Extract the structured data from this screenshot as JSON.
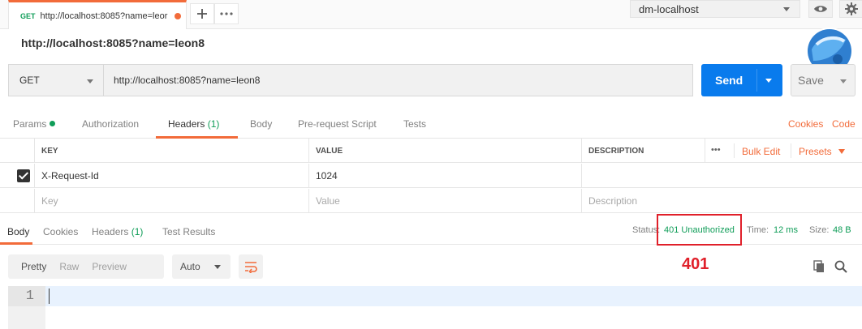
{
  "tab": {
    "method": "GET",
    "title": "http://localhost:8085?name=leor"
  },
  "environment": {
    "selected": "dm-localhost"
  },
  "request_name": "http://localhost:8085?name=leon8",
  "url_bar": {
    "method": "GET",
    "url": "http://localhost:8085?name=leon8",
    "send_label": "Send",
    "save_label": "Save"
  },
  "request_tabs": {
    "params": "Params",
    "authorization": "Authorization",
    "headers": "Headers",
    "headers_count": "(1)",
    "body": "Body",
    "pre_request": "Pre-request Script",
    "tests": "Tests",
    "cookies": "Cookies",
    "code": "Code"
  },
  "headers_table": {
    "col_key": "KEY",
    "col_value": "VALUE",
    "col_description": "DESCRIPTION",
    "more": "•••",
    "bulk_edit": "Bulk Edit",
    "presets": "Presets",
    "rows": [
      {
        "key": "X-Request-Id",
        "value": "1024",
        "description": ""
      }
    ],
    "placeholder": {
      "key": "Key",
      "value": "Value",
      "description": "Description"
    }
  },
  "response_tabs": {
    "body": "Body",
    "cookies": "Cookies",
    "headers": "Headers",
    "headers_count": "(1)",
    "test_results": "Test Results"
  },
  "status": {
    "status_label": "Status:",
    "status_value": "401 Unauthorized",
    "time_label": "Time:",
    "time_value": "12 ms",
    "size_label": "Size:",
    "size_value": "48 B"
  },
  "annotation": "401",
  "format": {
    "pretty": "Pretty",
    "raw": "Raw",
    "preview": "Preview",
    "auto": "Auto"
  },
  "editor": {
    "line_number": "1"
  },
  "colors": {
    "accent": "#f26b3a",
    "send": "#097bed",
    "success": "#0f9d58",
    "annotation": "#e0202a"
  }
}
